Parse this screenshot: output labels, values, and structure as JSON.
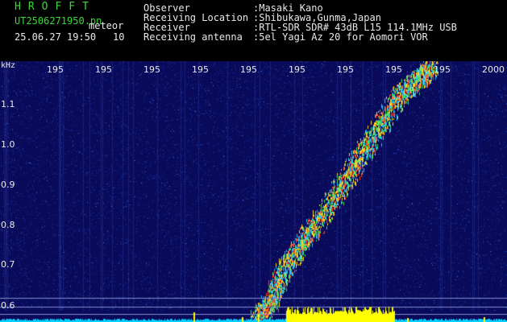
{
  "header": {
    "title": "HROFFT",
    "filename": "UT2506271950.pn",
    "tag": "meteor",
    "datetime": "25.06.27 19:50",
    "count": "10"
  },
  "meta": [
    {
      "key": "Observer",
      "value": ":Masaki Kano"
    },
    {
      "key": "Receiving Location",
      "value": ":Shibukawa,Gunma,Japan"
    },
    {
      "key": "Receiver",
      "value": ":RTL-SDR SDR# 43dB L15 114.1MHz USB"
    },
    {
      "key": "Receiving antenna",
      "value": ":5el Yagi Az 20 for Aomori VOR"
    }
  ],
  "axes": {
    "y_unit": "kHz",
    "x_ticks": [
      "195",
      "195",
      "195",
      "195",
      "195",
      "195",
      "195",
      "195",
      "195",
      "2000"
    ],
    "y_ticks": [
      "1.1",
      "1.0",
      "0.9",
      "0.8",
      "0.7",
      "0.6"
    ]
  },
  "colors": {
    "background": "#0a0a5a",
    "noise": "#1e3aa8",
    "trace_low": "#20c0ff",
    "trace_high": "#ff4020",
    "baseline": "#00d0ff",
    "burst": "#ffff00",
    "header_green": "#38d838"
  }
}
